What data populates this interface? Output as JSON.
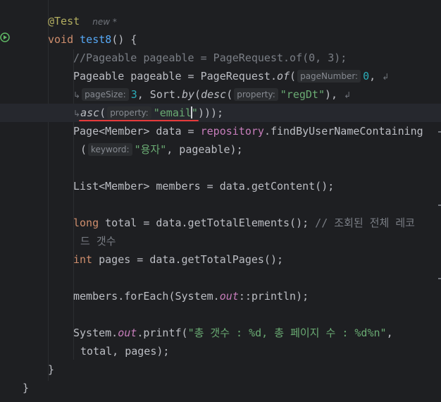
{
  "editor": {
    "lines": {
      "l1_annotation": "@Test",
      "l1_meta": "new *",
      "l2_void": "void",
      "l2_method": "test8",
      "l2_rest": "() {",
      "l3_comment": "//Pageable pageable = PageRequest.of(0, 3);",
      "l4_a": "Pageable pageable = PageRequest.",
      "l4_of": "of",
      "l4_paren": "(",
      "l4_hint": "pageNumber:",
      "l4_num": "0",
      "l4_comma": ",",
      "l5_hint": "pageSize:",
      "l5_num": "3",
      "l5_a": ", Sort.",
      "l5_by": "by",
      "l5_b": "(",
      "l5_desc": "desc",
      "l5_c": "(",
      "l5_hint2": "property:",
      "l5_str": "\"regDt\"",
      "l5_d": "),",
      "l6_asc": "asc",
      "l6_a": "(",
      "l6_hint": "property:",
      "l6_str_a": "\"email",
      "l6_str_b": "\"",
      "l6_b": ")));",
      "l7_a": "Page<Member> data = ",
      "l7_field": "repository",
      "l7_b": ".findByUserNameContaining",
      "l8_a": "(",
      "l8_hint": "keyword:",
      "l8_str": "\"용자\"",
      "l8_b": ", pageable);",
      "l9": "List<Member> members = data.getContent();",
      "l10_kw": "long",
      "l10_a": " total = data.getTotalElements(); ",
      "l10_comment": "// 조회된 전체 레코",
      "l11_comment": "드 갯수",
      "l12_kw": "int",
      "l12_a": " pages = data.getTotalPages();",
      "l13_a": "members.forEach(System.",
      "l13_out": "out",
      "l13_b": "::println);",
      "l14_a": "System.",
      "l14_out": "out",
      "l14_b": ".printf(",
      "l14_str": "\"총 갯수 : %d, 총 페이지 수 : %d%n\"",
      "l14_c": ",",
      "l15": "total, pages);",
      "l16": "}",
      "l17": "}"
    }
  },
  "colors": {
    "background": "#1e1f22",
    "keyword": "#cf8e6d",
    "method": "#56a8f5",
    "string": "#6aab73",
    "number": "#2aacb8",
    "comment": "#7a7e85",
    "annotation": "#b3ae60",
    "field": "#c77dbb",
    "error": "#e53a3a"
  },
  "icons": [
    "run-test-icon",
    "error-bulb-icon",
    "soft-wrap-icon"
  ]
}
